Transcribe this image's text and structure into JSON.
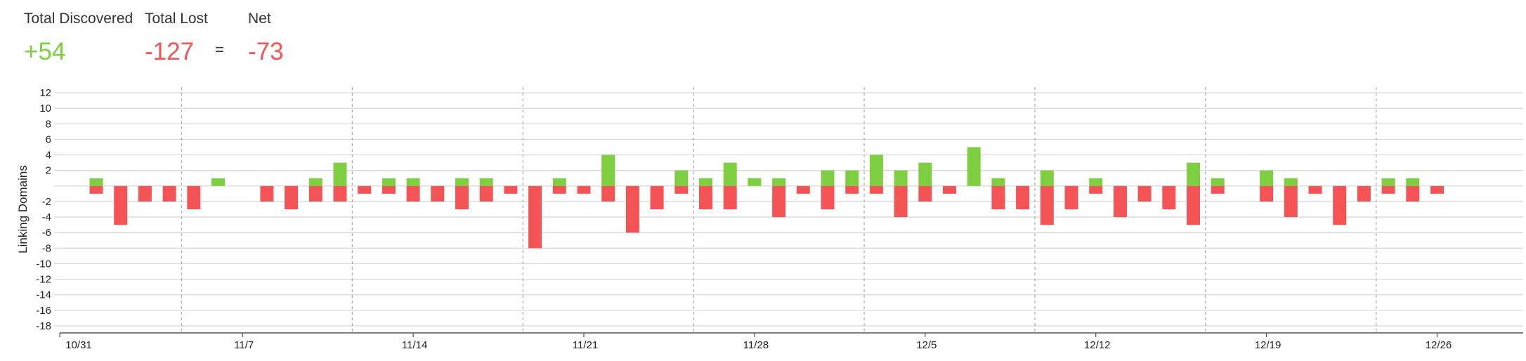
{
  "summary": {
    "discovered_label": "Total Discovered",
    "discovered_value": "+54",
    "lost_label": "Total Lost",
    "lost_value": "-127",
    "equals": "=",
    "net_label": "Net",
    "net_value": "-73"
  },
  "chart_data": {
    "type": "bar",
    "stacked": true,
    "ylabel": "Linking Domains",
    "ylim": [
      -18,
      12
    ],
    "yticks": [
      12,
      10,
      8,
      6,
      4,
      2,
      "",
      -2,
      -4,
      -6,
      -8,
      -10,
      -12,
      -14,
      -16,
      -18
    ],
    "x_tick_labels": [
      "10/31",
      "11/7",
      "11/14",
      "11/21",
      "11/28",
      "12/5",
      "12/12",
      "12/19",
      "12/26"
    ],
    "grid": true,
    "colors": {
      "discovered": "#7dcf3f",
      "lost": "#f45455",
      "grid": "#d9d9d9",
      "axis": "#555555"
    },
    "series": [
      {
        "key": "discovered",
        "values": [
          1,
          0,
          0,
          0,
          0,
          1,
          0,
          0,
          0,
          1,
          3,
          0,
          1,
          1,
          0,
          1,
          1,
          0,
          0,
          1,
          0,
          4,
          0,
          0,
          2,
          1,
          3,
          1,
          1,
          0,
          2,
          2,
          4,
          2,
          3,
          0,
          5,
          1,
          0,
          2,
          0,
          1,
          0,
          0,
          0,
          3,
          1,
          0,
          2,
          1,
          0,
          0,
          0,
          1,
          1,
          0
        ]
      },
      {
        "key": "lost",
        "values": [
          -1,
          -5,
          -2,
          -2,
          -3,
          0,
          0,
          -2,
          -3,
          -2,
          -2,
          -1,
          -1,
          -2,
          -2,
          -3,
          -2,
          -1,
          -8,
          -1,
          -1,
          -2,
          -6,
          -3,
          -1,
          -3,
          -3,
          0,
          -4,
          -1,
          -3,
          -1,
          -1,
          -4,
          -2,
          -1,
          0,
          -3,
          -3,
          -5,
          -3,
          -1,
          -4,
          -2,
          -3,
          -5,
          -1,
          0,
          -2,
          -4,
          -1,
          -5,
          -2,
          -1,
          -2,
          -1
        ]
      }
    ]
  }
}
